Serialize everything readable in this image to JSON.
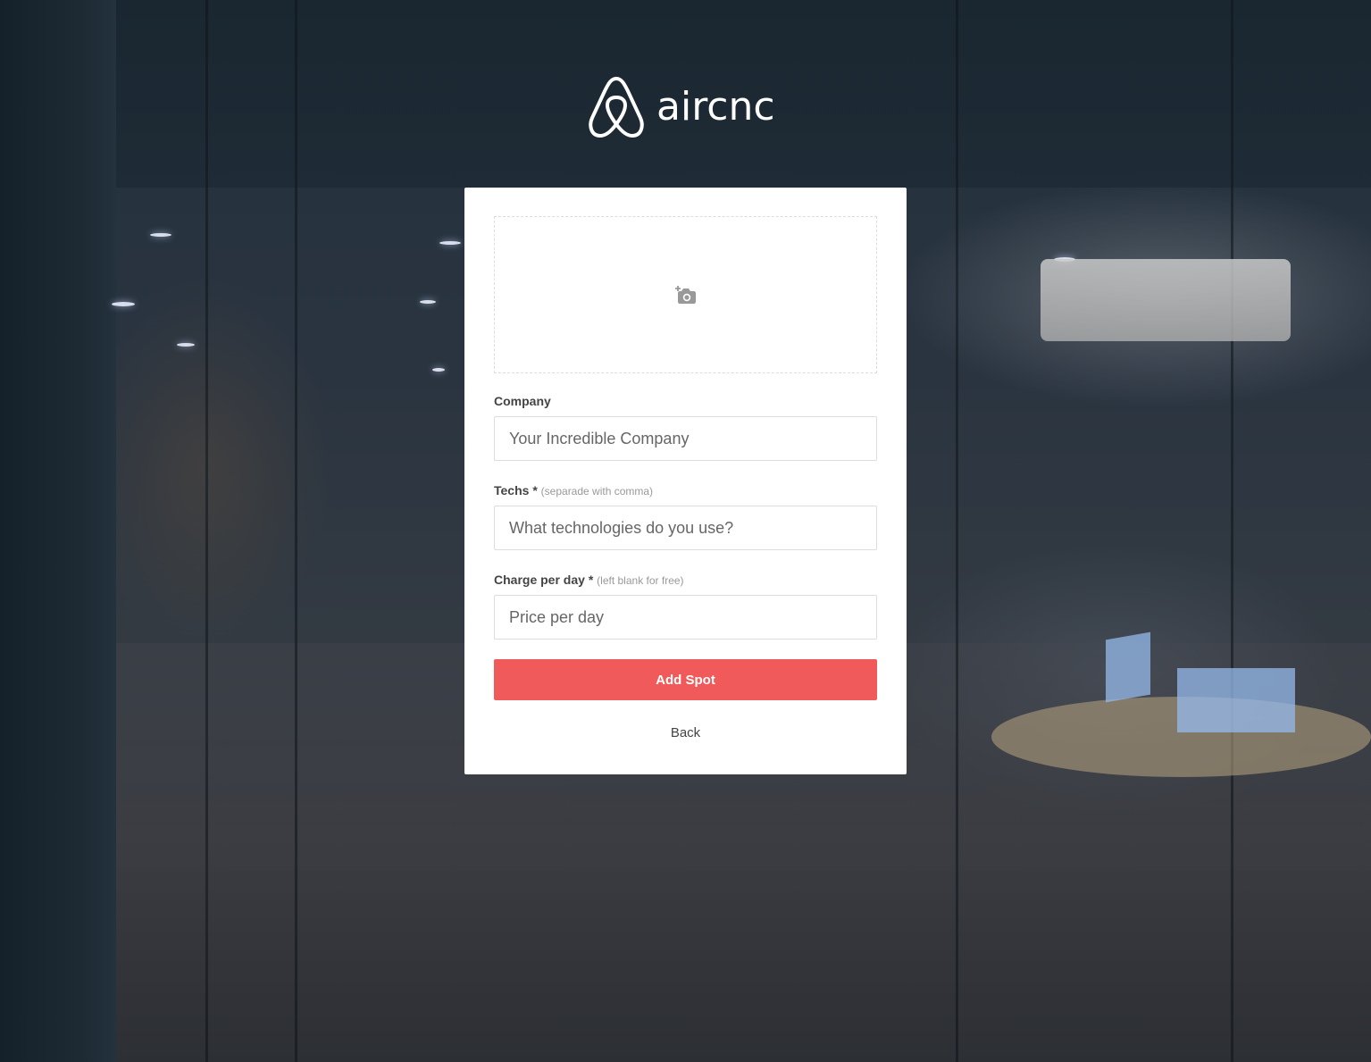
{
  "brand": {
    "name": "aircnc",
    "logo_icon": "airbnb-belo-icon"
  },
  "form": {
    "thumbnail": {
      "icon": "add-photo-icon",
      "icon_color": "#999999"
    },
    "company": {
      "label": "Company",
      "placeholder": "Your Incredible Company"
    },
    "techs": {
      "label": "Techs",
      "required_mark": "*",
      "hint": "(separade with comma)",
      "placeholder": "What technologies do you use?"
    },
    "price": {
      "label": "Charge per day",
      "required_mark": "*",
      "hint": "(left blank for free)",
      "placeholder": "Price per day"
    },
    "submit_label": "Add Spot",
    "back_label": "Back"
  },
  "colors": {
    "accent": "#f05a5b",
    "card_background": "#ffffff",
    "label_text": "#444444",
    "hint_text": "#999999"
  }
}
